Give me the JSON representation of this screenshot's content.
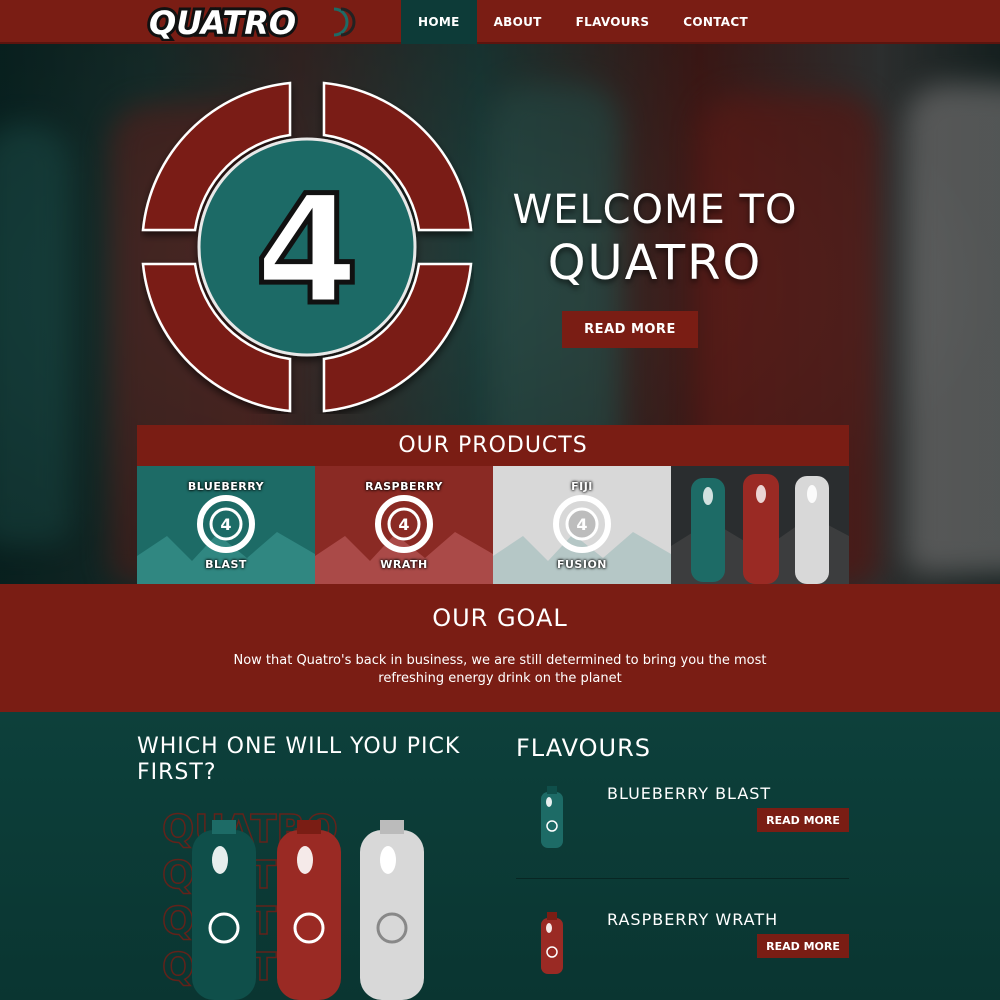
{
  "nav": {
    "logo_text": "QUATRO",
    "links": [
      "HOME",
      "ABOUT",
      "FLAVOURS",
      "CONTACT"
    ],
    "active": "HOME"
  },
  "hero": {
    "emblem_text": "4",
    "title_line1": "WELCOME TO",
    "title_line2": "QUATRO",
    "button": "READ MORE"
  },
  "products": {
    "heading": "OUR PRODUCTS",
    "tiles": [
      {
        "top": "BLUEBERRY",
        "bottom": "BLAST",
        "color": "#1d6b66"
      },
      {
        "top": "RASPBERRY",
        "bottom": "WRATH",
        "color": "#8a2a24"
      },
      {
        "top": "FIJI",
        "bottom": "FUSION",
        "color": "#d8d8d8"
      },
      {
        "top": "",
        "bottom": "",
        "color": "#2a2d2f"
      }
    ]
  },
  "goal": {
    "heading": "OUR GOAL",
    "text": "Now that Quatro's back in business, we are still determined to bring you the most refreshing energy drink on the planet"
  },
  "pick": {
    "heading": "WHICH ONE WILL YOU PICK FIRST?"
  },
  "flavours": {
    "heading": "FLAVOURS",
    "items": [
      {
        "name": "BLUEBERRY BLAST",
        "button": "READ MORE",
        "color": "#1d6b66"
      },
      {
        "name": "RASPBERRY WRATH",
        "button": "READ MORE",
        "color": "#9a2a24"
      }
    ]
  },
  "colors": {
    "brand_red": "#7a1d14",
    "brand_teal": "#0d3b38"
  }
}
